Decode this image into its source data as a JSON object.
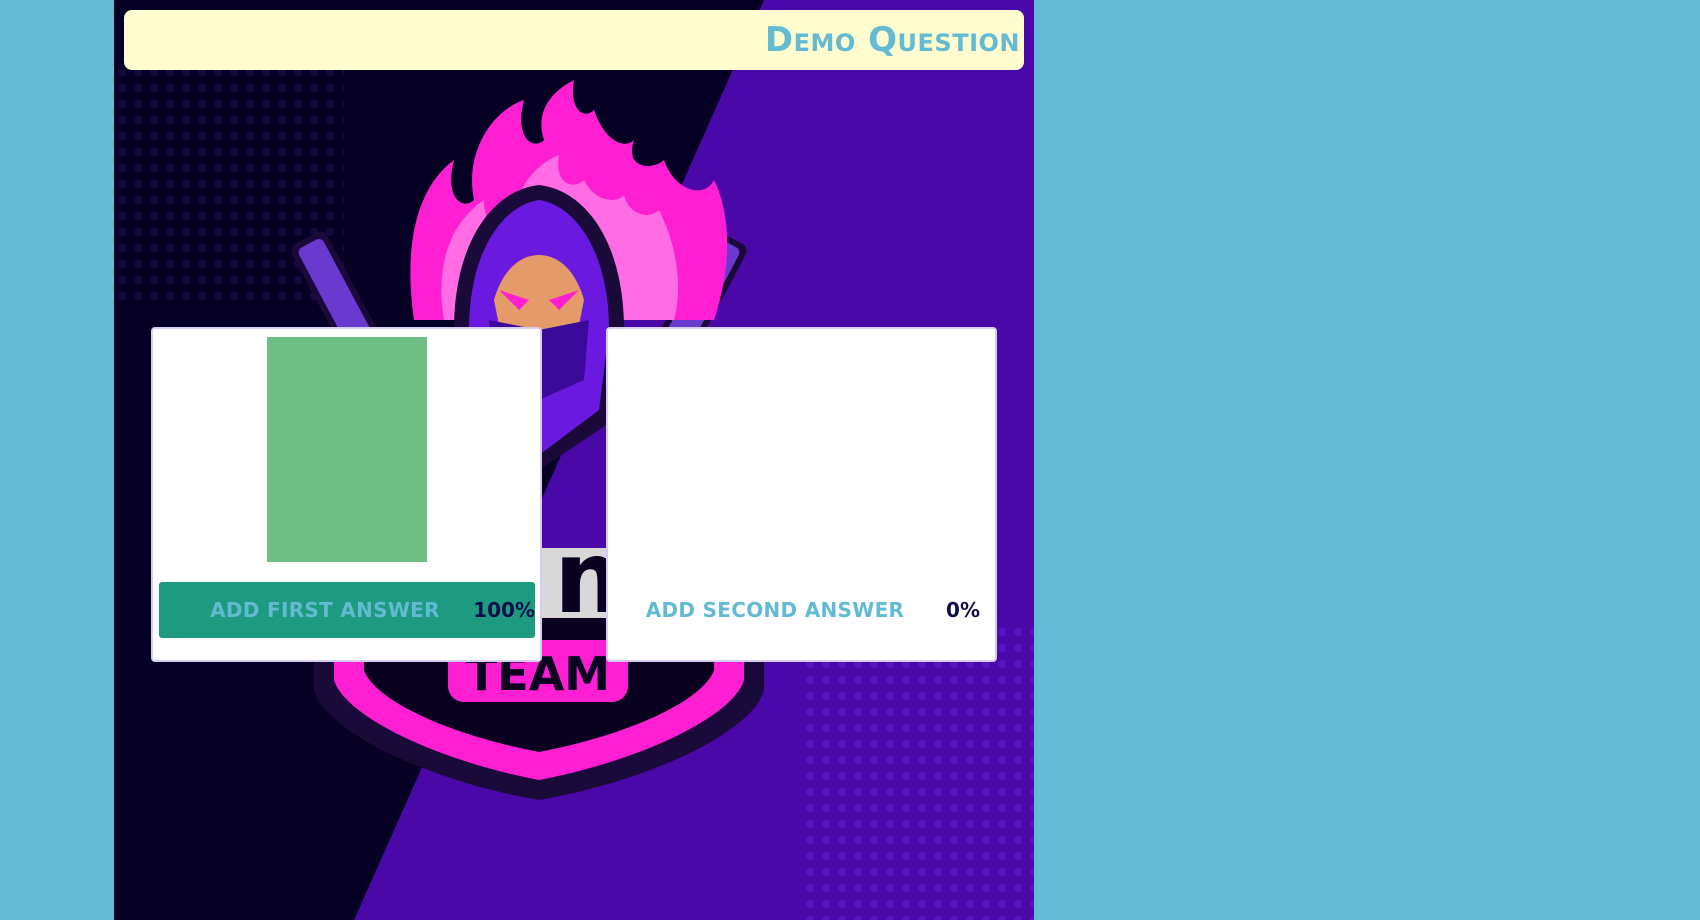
{
  "question": {
    "title": "Demo Question"
  },
  "logo": {
    "team_text": "TEAM"
  },
  "answers": [
    {
      "label": "Add first answer",
      "percent": "100%",
      "share": 1.0,
      "selected": true
    },
    {
      "label": "Add second answer",
      "percent": "0%",
      "share": 0.0,
      "selected": false
    }
  ],
  "colors": {
    "page_background": "#62BBD3",
    "question_bar": "#FFFDCF",
    "question_text": "#62BBD3",
    "vote_bar": "#6DBF85",
    "selected_answer": "#1D9A80",
    "answer_text": "#62BBD3",
    "percent_text": "#0d0f4a",
    "logo_magenta": "#FF1FD2",
    "logo_purple": "#5a12c8"
  }
}
